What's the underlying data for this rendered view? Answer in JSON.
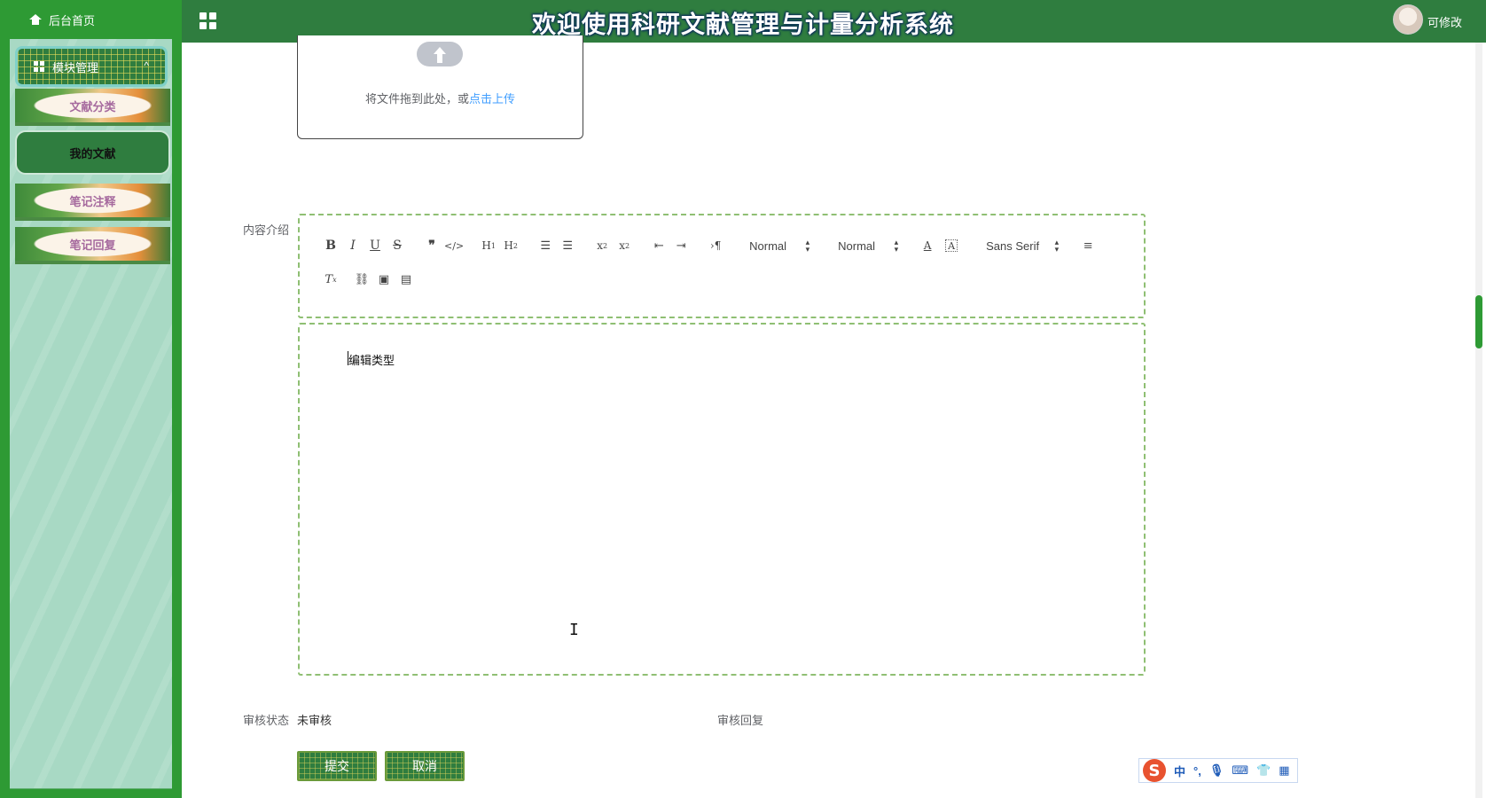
{
  "header": {
    "title": "欢迎使用科研文献管理与计量分析系统",
    "user_name": "可修改"
  },
  "sidebar": {
    "home_label": "后台首页",
    "module_label": "模块管理",
    "module_chevron": "^",
    "items": [
      {
        "label": "文献分类",
        "active": false
      },
      {
        "label": "我的文献",
        "active": true
      },
      {
        "label": "笔记注释",
        "active": false
      },
      {
        "label": "笔记回复",
        "active": false
      }
    ]
  },
  "upload": {
    "text_prefix": "将文件拖到此处，或",
    "link_text": "点击上传"
  },
  "form": {
    "content_label": "内容介绍",
    "status_label": "审核状态",
    "status_value": "未审核",
    "reply_label": "审核回复"
  },
  "editor": {
    "toolbar_row1": [
      "bold",
      "italic",
      "underline",
      "strike",
      "blockquote",
      "code-block",
      "h1",
      "h2",
      "ordered-list",
      "bullet-list",
      "subscript",
      "superscript",
      "outdent",
      "indent",
      "direction"
    ],
    "selects": [
      "Normal",
      "Normal",
      "Sans Serif"
    ],
    "toolbar_row2": [
      "clean",
      "link",
      "image",
      "video"
    ],
    "content": "编辑类型"
  },
  "buttons": {
    "submit": "提交",
    "cancel": "取消"
  },
  "ime": {
    "logo": "S",
    "items": [
      "中",
      "°,",
      "mic",
      "keyboard",
      "shirt",
      "grid"
    ]
  },
  "colors": {
    "header_bg": "#2f7d3f",
    "sidebar_frame": "#2e9a34",
    "sidebar_bg": "#a8d9c4",
    "link": "#409eff",
    "editor_border": "#8fbf73"
  }
}
